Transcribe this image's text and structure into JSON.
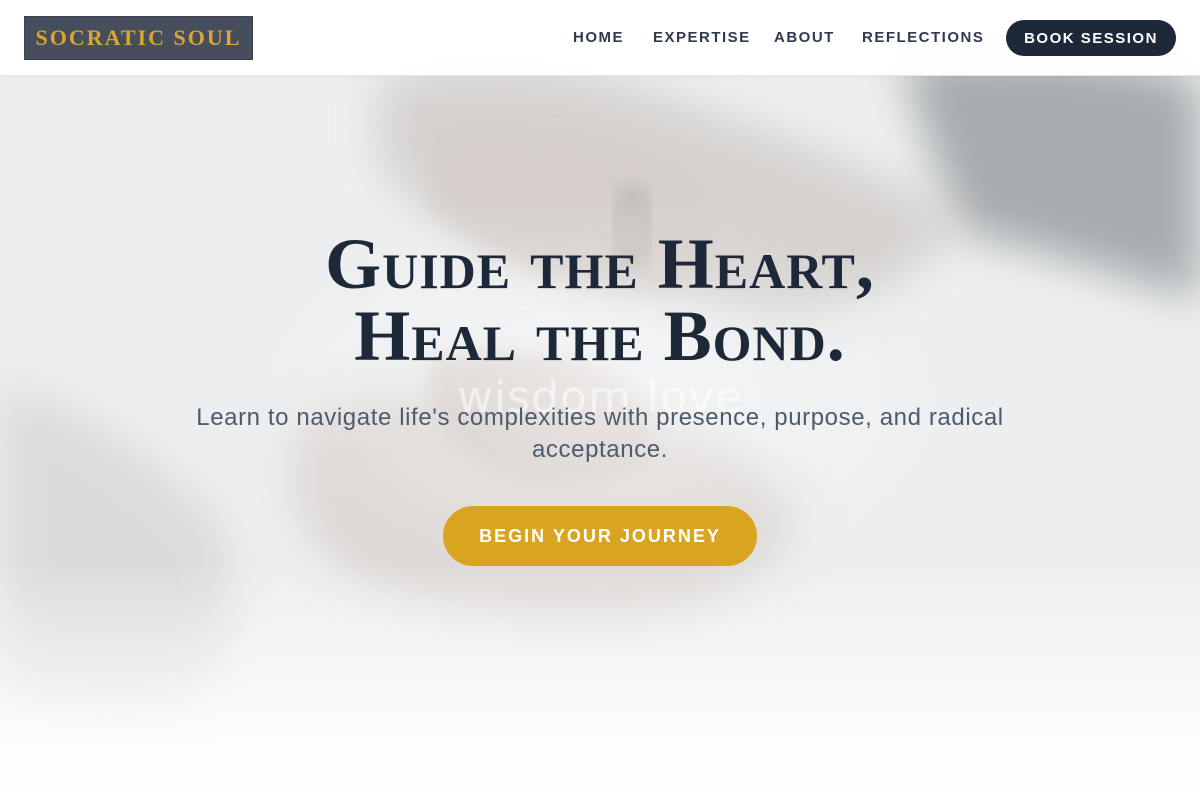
{
  "brand": {
    "name": "SOCRATIC SOUL"
  },
  "nav": {
    "items": [
      {
        "label": "HOME"
      },
      {
        "label": "EXPERTISE"
      },
      {
        "label": "ABOUT"
      },
      {
        "label": "REFLECTIONS"
      }
    ],
    "cta_label": "BOOK SESSION"
  },
  "hero": {
    "title_line1": "Guide the Heart,",
    "title_line2": "Heal the Bond.",
    "subtitle": "Learn to navigate life's complexities with presence, purpose, and radical acceptance.",
    "cta_label": "BEGIN YOUR JOURNEY",
    "background_watermark": "wisdom love"
  },
  "colors": {
    "navy": "#1d2838",
    "gold": "#d9a521",
    "logo_bg": "#464d5c",
    "logo_text": "#d9a62e",
    "subtitle": "#4d5b6e"
  }
}
